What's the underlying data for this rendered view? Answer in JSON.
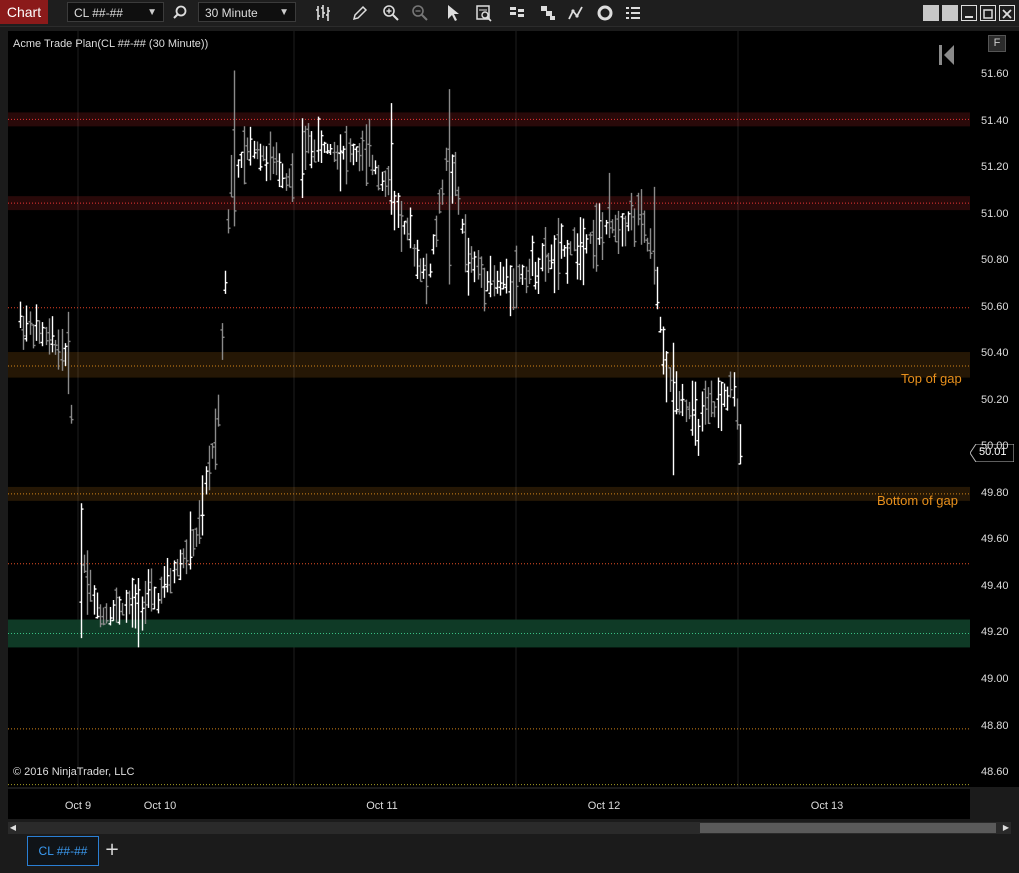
{
  "toolbar": {
    "chart_tab": "Chart",
    "instrument": "CL ##-##",
    "interval": "30 Minute"
  },
  "chart": {
    "title": "Acme Trade Plan(CL ##-## (30 Minute))",
    "copyright": "© 2016 NinjaTrader, LLC",
    "current_price": "50.01",
    "f_button": "F",
    "zone_labels": {
      "top_of_gap": "Top of gap",
      "bottom_of_gap": "Bottom of gap"
    }
  },
  "chart_data": {
    "type": "ohlc",
    "y_ticks": [
      "51.60",
      "51.40",
      "51.20",
      "51.00",
      "50.80",
      "50.60",
      "50.40",
      "50.20",
      "50.00",
      "49.80",
      "49.60",
      "49.40",
      "49.20",
      "49.00",
      "48.80",
      "48.60"
    ],
    "x_ticks": [
      "Oct 9",
      "Oct 10",
      "Oct 11",
      "Oct 12",
      "Oct 13"
    ],
    "ylim": [
      48.54,
      51.79
    ],
    "levels": [
      {
        "price": 51.41,
        "color": "#ff3b3b",
        "band": [
          51.38,
          51.44
        ]
      },
      {
        "price": 51.05,
        "color": "#ff3b3b",
        "band": [
          51.02,
          51.08
        ]
      },
      {
        "price": 50.6,
        "color": "#ff4a2a"
      },
      {
        "price": 50.35,
        "color": "#e8901c",
        "band": [
          50.3,
          50.41
        ],
        "label": "Top of gap"
      },
      {
        "price": 49.8,
        "color": "#e8901c",
        "band": [
          49.77,
          49.83
        ],
        "label": "Bottom of gap"
      },
      {
        "price": 49.5,
        "color": "#ff5a2a"
      },
      {
        "price": 49.2,
        "color": "#3ecf8e",
        "band": [
          49.14,
          49.26
        ],
        "fill": "#0f3a26"
      },
      {
        "price": 48.79,
        "color": "#e8901c"
      },
      {
        "price": 48.55,
        "color": "#b8b02a"
      }
    ]
  },
  "tabs": {
    "instrument_tab": "CL ##-##",
    "add_tab": "+"
  }
}
